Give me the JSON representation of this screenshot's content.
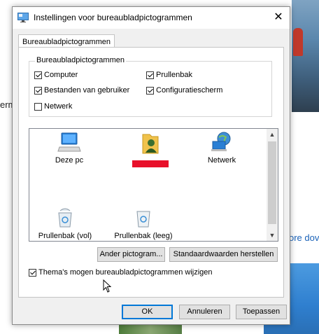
{
  "background": {
    "left_text_fragment": "erm",
    "right_link_fragment": "ore dov"
  },
  "dialog": {
    "title": "Instellingen voor bureaubladpictogrammen",
    "close_glyph": "✕",
    "tab_label": "Bureaubladpictogrammen",
    "group": {
      "label": "Bureaubladpictogrammen",
      "checkboxes": [
        {
          "label": "Computer",
          "checked": true
        },
        {
          "label": "Prullenbak",
          "checked": true
        },
        {
          "label": "Bestanden van gebruiker",
          "checked": true
        },
        {
          "label": "Configuratiescherm",
          "checked": true
        },
        {
          "label": "Netwerk",
          "checked": false
        }
      ]
    },
    "icons": [
      {
        "label": "Deze pc",
        "icon": "computer-icon"
      },
      {
        "label": "",
        "icon": "user-folder-icon",
        "redacted": true
      },
      {
        "label": "Netwerk",
        "icon": "network-icon"
      },
      {
        "label": "Prullenbak (vol)",
        "icon": "recycle-bin-full-icon"
      },
      {
        "label": "Prullenbak (leeg)",
        "icon": "recycle-bin-empty-icon"
      }
    ],
    "buttons": {
      "change_icon": "Ander pictogram...",
      "restore_default": "Standaardwaarden herstellen",
      "ok": "OK",
      "cancel": "Annuleren",
      "apply": "Toepassen"
    },
    "themes_checkbox": {
      "label": "Thema's mogen bureaubladpictogrammen wijzigen",
      "checked": true
    }
  },
  "colors": {
    "accent": "#0078d7",
    "redaction": "#e8102a"
  }
}
